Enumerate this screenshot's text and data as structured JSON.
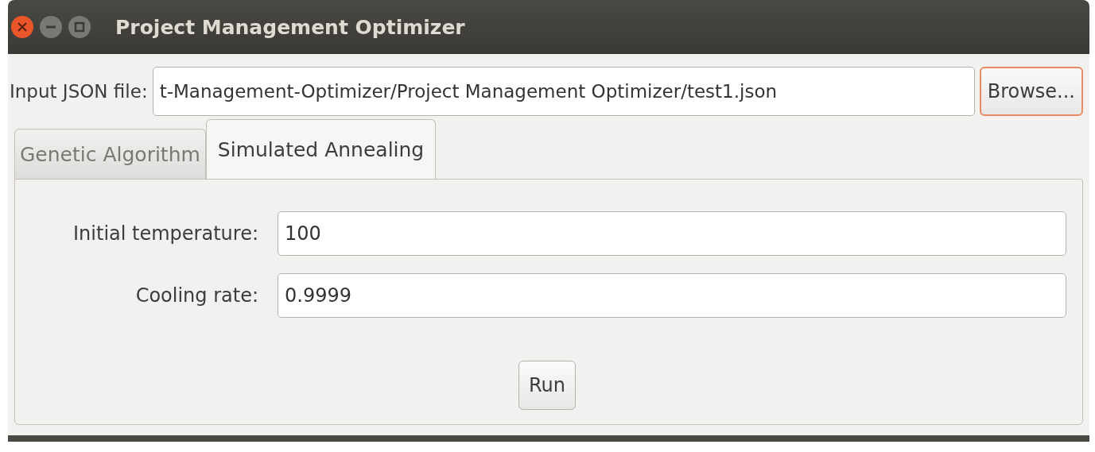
{
  "window": {
    "title": "Project Management Optimizer"
  },
  "file_row": {
    "label": "Input JSON file:",
    "value": "t-Management-Optimizer/Project Management Optimizer/test1.json",
    "button": {
      "label": "Browse...",
      "focused": true
    }
  },
  "tabs": [
    {
      "label": "Genetic Algorithm",
      "selected": false
    },
    {
      "label": "Simulated Annealing",
      "selected": true
    }
  ],
  "fields": [
    {
      "label": "Initial temperature:",
      "value": "100"
    },
    {
      "label": "Cooling rate:",
      "value": "0.9999"
    }
  ],
  "run_button": {
    "label": "Run"
  }
}
